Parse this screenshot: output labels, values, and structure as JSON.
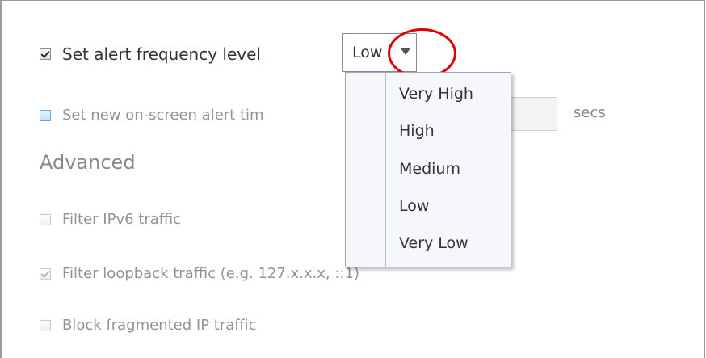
{
  "settings": {
    "alert_frequency": {
      "label": "Set alert frequency level",
      "checked": true,
      "selected": "Low"
    },
    "onscreen_alert": {
      "label": "Set new on-screen alert tim",
      "checked": false,
      "units": "secs"
    },
    "advanced": {
      "title": "Advanced",
      "filter_ipv6": {
        "label": "Filter IPv6 traffic",
        "checked": false
      },
      "filter_loopback": {
        "label": "Filter loopback traffic (e.g. 127.x.x.x, ::1)",
        "checked": true
      },
      "block_fragmented": {
        "label": "Block fragmented IP traffic",
        "checked": false
      }
    }
  },
  "dropdown": {
    "options": [
      "Very High",
      "High",
      "Medium",
      "Low",
      "Very Low"
    ]
  },
  "annotation": {
    "color": "#e00000"
  }
}
